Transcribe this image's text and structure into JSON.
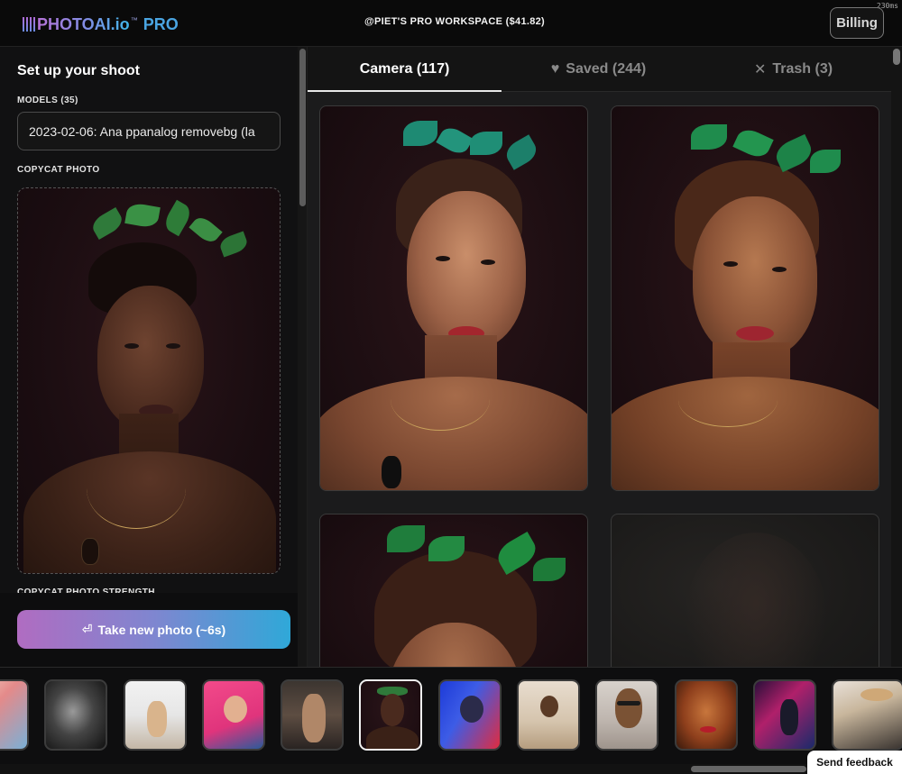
{
  "app": {
    "logo_text": "PHOTOAI.io",
    "logo_tm": "™",
    "logo_pro": "PRO",
    "workspace": "@PIET'S PRO WORKSPACE ($41.82)",
    "timer": "230ms",
    "billing_label": "Billing"
  },
  "sidebar": {
    "title": "Set up your shoot",
    "models_label": "MODELS (35)",
    "model_value": "2023-02-06: Ana ppanalog removebg (la",
    "copycat_label": "COPYCAT PHOTO",
    "strength_label": "COPYCAT PHOTO STRENGTH",
    "take_photo_label": "Take new photo (~6s)",
    "take_photo_icon": "return-arrow-icon"
  },
  "tabs": [
    {
      "label": "Camera (117)",
      "icon": "",
      "active": true
    },
    {
      "label": "Saved (244)",
      "icon": "heart-icon",
      "active": false
    },
    {
      "label": "Trash (3)",
      "icon": "close-icon",
      "active": false
    }
  ],
  "gallery": {
    "items": [
      "portrait-1",
      "portrait-2",
      "portrait-3",
      "portrait-4"
    ]
  },
  "strip": {
    "thumbnails": [
      {
        "name": "beach-swimwear",
        "selected": false
      },
      {
        "name": "bw-hair-motion",
        "selected": false
      },
      {
        "name": "sitting-studio",
        "selected": false
      },
      {
        "name": "pink-wall",
        "selected": false
      },
      {
        "name": "lingerie-dark",
        "selected": false
      },
      {
        "name": "leaf-crown-portrait",
        "selected": true
      },
      {
        "name": "neon-blue-red",
        "selected": false
      },
      {
        "name": "bed-lounging",
        "selected": false
      },
      {
        "name": "glasses-sweater",
        "selected": false
      },
      {
        "name": "redhead-closeup",
        "selected": false
      },
      {
        "name": "neon-night-street",
        "selected": false
      },
      {
        "name": "car-hat",
        "selected": false
      }
    ]
  },
  "feedback_label": "Send feedback",
  "colors": {
    "accent_gradient_start": "#b06cc1",
    "accent_gradient_end": "#2fa8d8",
    "background": "#0b0b0c",
    "panel": "#111112"
  }
}
